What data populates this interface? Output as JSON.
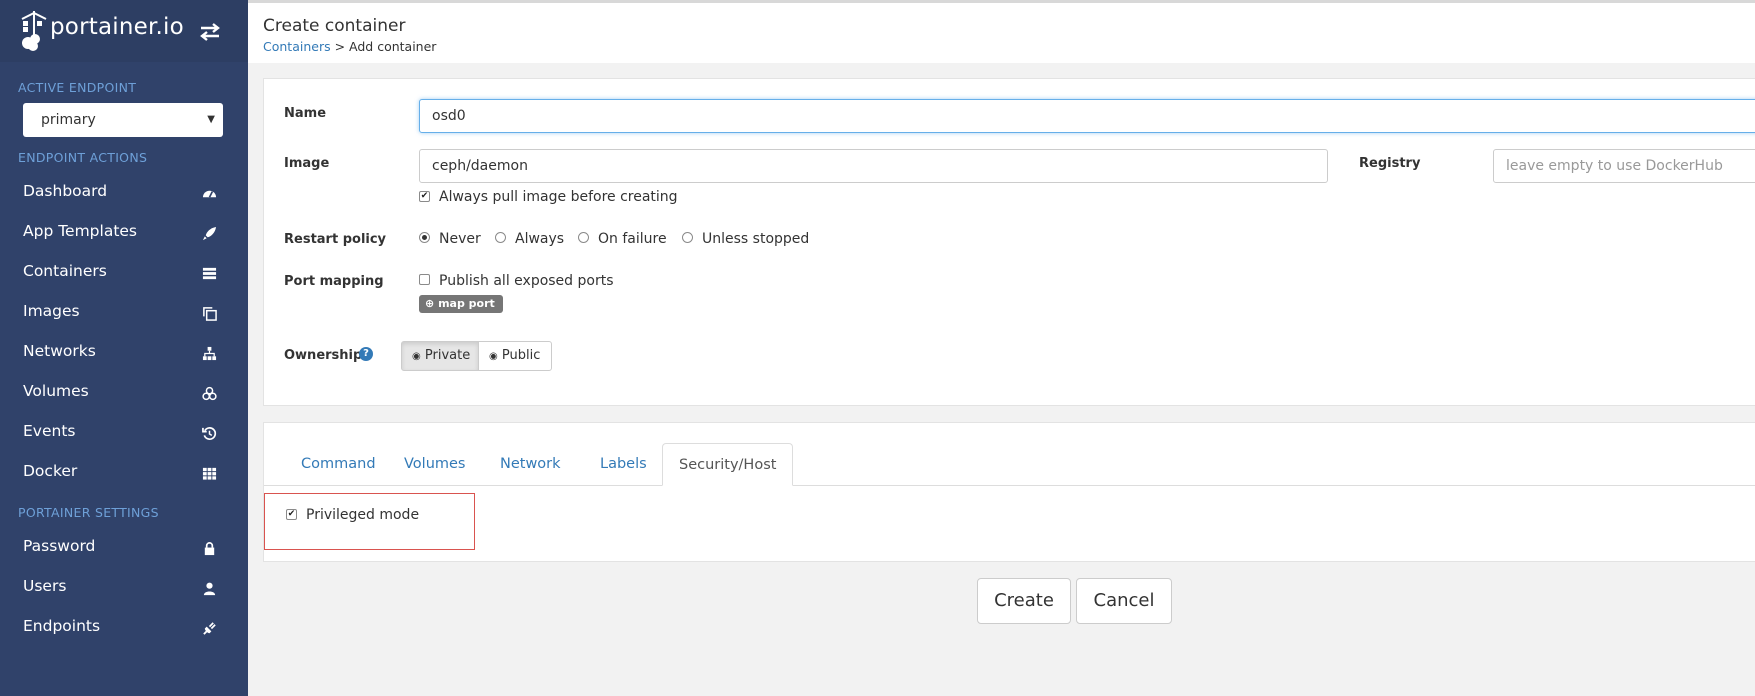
{
  "brand": {
    "name": "portainer.io"
  },
  "sidebar": {
    "active_endpoint_heading": "ACTIVE ENDPOINT",
    "endpoint_selected": "primary",
    "endpoint_actions_heading": "ENDPOINT ACTIONS",
    "endpoint_items": [
      {
        "label": "Dashboard",
        "icon": "dashboard-icon"
      },
      {
        "label": "App Templates",
        "icon": "rocket-icon"
      },
      {
        "label": "Containers",
        "icon": "server-icon"
      },
      {
        "label": "Images",
        "icon": "clone-icon"
      },
      {
        "label": "Networks",
        "icon": "sitemap-icon"
      },
      {
        "label": "Volumes",
        "icon": "cubes-icon"
      },
      {
        "label": "Events",
        "icon": "history-icon"
      },
      {
        "label": "Docker",
        "icon": "grid-icon"
      }
    ],
    "portainer_settings_heading": "PORTAINER SETTINGS",
    "settings_items": [
      {
        "label": "Password",
        "icon": "lock-icon"
      },
      {
        "label": "Users",
        "icon": "user-icon"
      },
      {
        "label": "Endpoints",
        "icon": "plug-icon"
      }
    ]
  },
  "header": {
    "title": "Create container",
    "breadcrumb_link": "Containers",
    "breadcrumb_rest": " > Add container"
  },
  "form": {
    "name_label": "Name",
    "name_value": "osd0",
    "image_label": "Image",
    "image_value": "ceph/daemon",
    "registry_label": "Registry",
    "registry_placeholder": "leave empty to use DockerHub",
    "always_pull_label": "Always pull image before creating",
    "always_pull_checked": true,
    "restart_policy_label": "Restart policy",
    "restart_options": [
      "Never",
      "Always",
      "On failure",
      "Unless stopped"
    ],
    "restart_selected": "Never",
    "port_mapping_label": "Port mapping",
    "publish_all_label": "Publish all exposed ports",
    "publish_all_checked": false,
    "map_port_button": "map port",
    "ownership_label": "Ownership",
    "ownership_options": [
      "Private",
      "Public"
    ],
    "ownership_selected": "Private"
  },
  "tabs": {
    "items": [
      "Command",
      "Volumes",
      "Network",
      "Labels",
      "Security/Host"
    ],
    "active": "Security/Host",
    "privileged_mode_label": "Privileged mode",
    "privileged_mode_checked": true
  },
  "actions": {
    "create": "Create",
    "cancel": "Cancel"
  },
  "colors": {
    "sidebar_bg": "#30426a",
    "sidebar_heading": "#6ea0d8",
    "link": "#337ab7",
    "highlight_border": "#d9534f"
  }
}
